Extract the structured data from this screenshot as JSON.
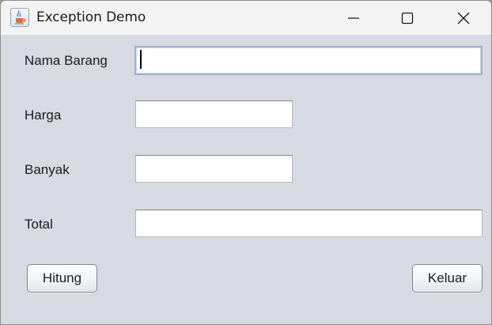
{
  "window": {
    "title": "Exception Demo",
    "icon": "java-cup-icon"
  },
  "form": {
    "nama_barang": {
      "label": "Nama Barang",
      "value": ""
    },
    "harga": {
      "label": "Harga",
      "value": ""
    },
    "banyak": {
      "label": "Banyak",
      "value": ""
    },
    "total": {
      "label": "Total",
      "value": ""
    }
  },
  "buttons": {
    "hitung": "Hitung",
    "keluar": "Keluar"
  },
  "colors": {
    "window_bg": "#d7dae2",
    "titlebar_bg": "#f3f3f3",
    "focus_border": "#9ab3cf"
  }
}
